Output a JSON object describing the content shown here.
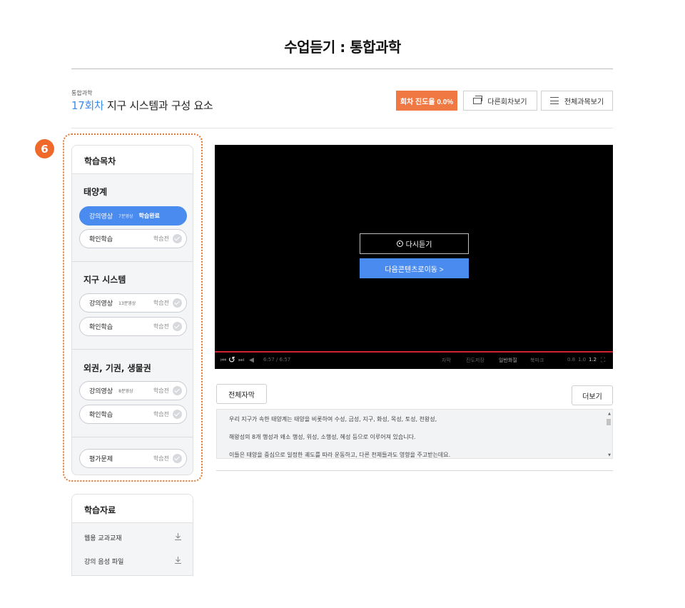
{
  "page": {
    "title": "수업듣기 : 통합과학"
  },
  "lesson": {
    "subject": "통합과학",
    "number": "17회차",
    "name": "지구 시스템과 구성 요소"
  },
  "header_buttons": {
    "progress": "회차 진도율 0.0%",
    "other_sessions": "다른회차보기",
    "all_subjects": "전체과목보기"
  },
  "step_badge": "6",
  "toc": {
    "title": "학습목차",
    "sections": [
      {
        "title": "태양계",
        "items": [
          {
            "name": "강의영상",
            "duration": "7분영상",
            "status": "학습완료",
            "active": true
          },
          {
            "name": "확인학습",
            "duration": "",
            "status": "학습전",
            "active": false
          }
        ]
      },
      {
        "title": "지구 시스템",
        "items": [
          {
            "name": "강의영상",
            "duration": "13분영상",
            "status": "학습전",
            "active": false
          },
          {
            "name": "확인학습",
            "duration": "",
            "status": "학습전",
            "active": false
          }
        ]
      },
      {
        "title": "외권, 기권, 생물권",
        "items": [
          {
            "name": "강의영상",
            "duration": "8분영상",
            "status": "학습전",
            "active": false
          },
          {
            "name": "확인학습",
            "duration": "",
            "status": "학습전",
            "active": false
          }
        ]
      }
    ],
    "evaluation": {
      "name": "평가문제",
      "status": "학습전"
    }
  },
  "materials": {
    "title": "학습자료",
    "items": [
      "웹용 교과교재",
      "강의 음성 파일"
    ]
  },
  "video": {
    "replay_label": "다시듣기",
    "next_label": "다음콘텐츠로이동 >",
    "time": "6:57 / 6:57",
    "controls": {
      "subtitle": "자막",
      "progress_save": "진도저장",
      "quality": "일반화질",
      "bookmark": "북마크",
      "speeds": [
        "0.8",
        "1.0",
        "1.2"
      ]
    }
  },
  "transcript": {
    "button_label": "전체자막",
    "more_label": "더보기",
    "lines": [
      "우리 지구가 속한 태양계는 태양을 비롯하여 수성, 금성, 지구, 화성, 목성, 토성, 천왕성,",
      "해왕성의 8개 행성과 왜소 행성, 위성, 소행성, 혜성 등으로 이루어져 있습니다.",
      "이들은 태양을 중심으로 일정한 궤도를 따라 운동하고, 다른 천체들과도 영향을 주고받는데요."
    ]
  },
  "colors": {
    "accent_blue": "#4a8bf0",
    "badge_orange": "#ef6a2a",
    "progress_button": "#f07843",
    "video_progress": "#cc2233"
  }
}
